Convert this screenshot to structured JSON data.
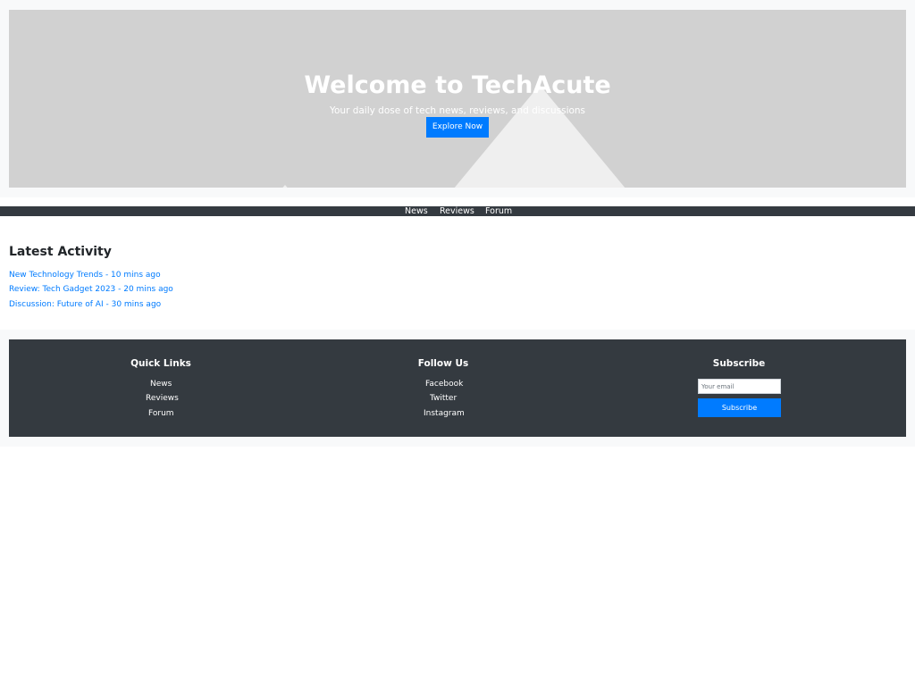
{
  "hero": {
    "title": "Welcome to TechAcute",
    "subtitle": "Your daily dose of tech news, reviews, and discussions",
    "cta_label": "Explore Now"
  },
  "nav": {
    "items": [
      {
        "label": "News"
      },
      {
        "label": "Reviews"
      },
      {
        "label": "Forum"
      }
    ]
  },
  "activity": {
    "title": "Latest Activity",
    "items": [
      {
        "text": "New Technology Trends - 10 mins ago"
      },
      {
        "text": "Review: Tech Gadget 2023 - 20 mins ago"
      },
      {
        "text": "Discussion: Future of AI - 30 mins ago"
      }
    ]
  },
  "footer": {
    "quick_links": {
      "title": "Quick Links",
      "items": [
        {
          "label": "News"
        },
        {
          "label": "Reviews"
        },
        {
          "label": "Forum"
        }
      ]
    },
    "follow": {
      "title": "Follow Us",
      "items": [
        {
          "label": "Facebook"
        },
        {
          "label": "Twitter"
        },
        {
          "label": "Instagram"
        }
      ]
    },
    "subscribe": {
      "title": "Subscribe",
      "email_placeholder": "Your email",
      "button_label": "Subscribe"
    }
  },
  "colors": {
    "accent": "#007bff",
    "dark": "#343a40",
    "hero_bg": "#d1d1d1",
    "light_bg": "#f8f9fa"
  }
}
